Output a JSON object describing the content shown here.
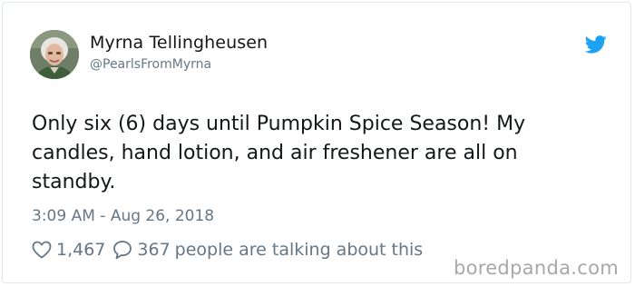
{
  "user": {
    "display_name": "Myrna Tellingheusen",
    "handle": "@PearlsFromMyrna"
  },
  "tweet": {
    "text": "Only six (6) days until Pumpkin Spice Season! My candles, hand lotion, and air freshener are all on standby.",
    "timestamp": "3:09 AM - Aug 26, 2018",
    "likes": "1,467",
    "replies": "367",
    "talking_label": "people are talking about this"
  },
  "watermark": "boredpanda.com",
  "icons": {
    "brand": "twitter-bird-icon",
    "like": "heart-icon",
    "reply": "speech-bubble-icon"
  },
  "colors": {
    "twitter_blue": "#1da1f2",
    "text_primary": "#14171a",
    "text_secondary": "#657786",
    "border": "#e1e8ed",
    "watermark": "#a8a8a8"
  }
}
